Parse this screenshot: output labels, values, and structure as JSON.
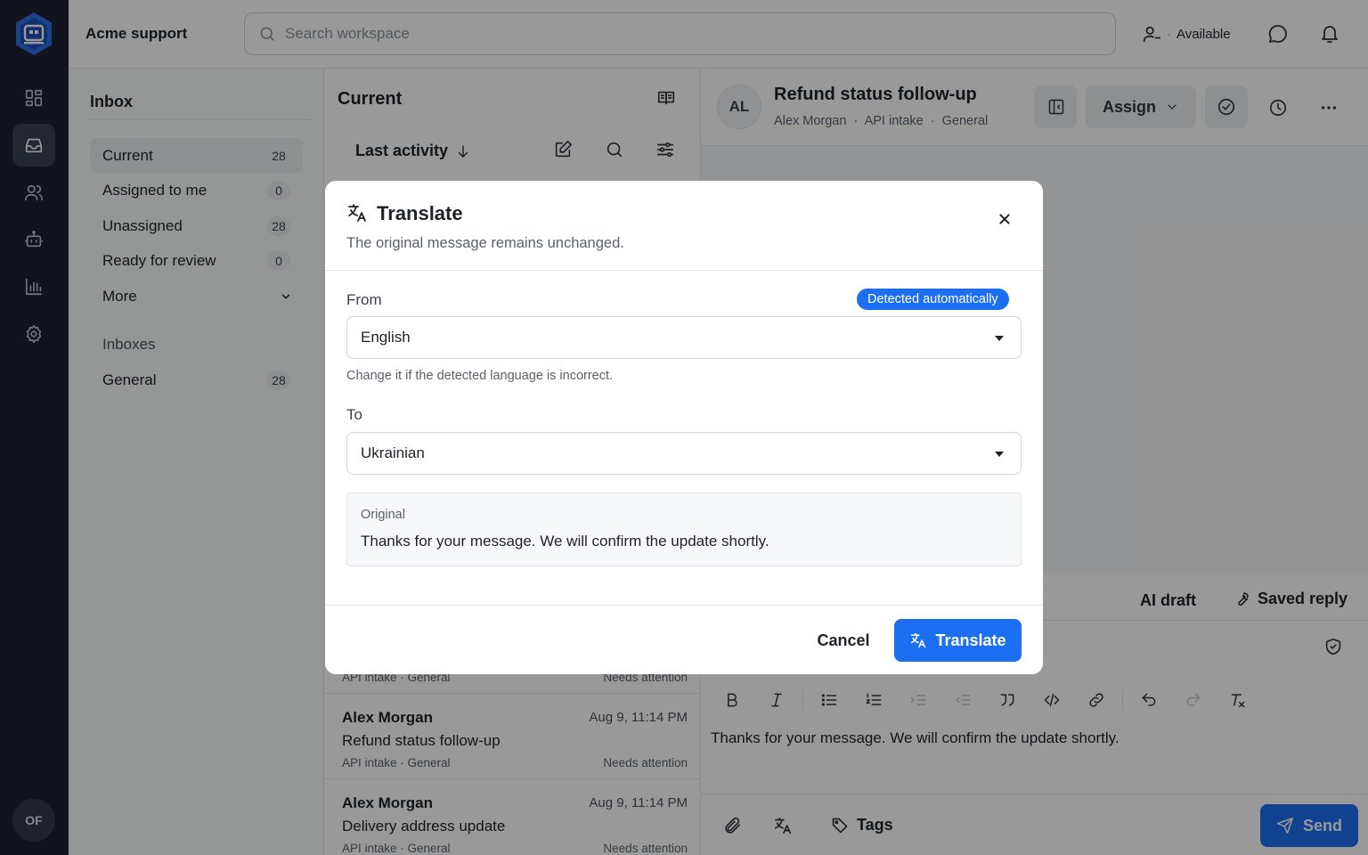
{
  "app": {
    "workspace_name": "Acme support",
    "user_initials": "OF",
    "status": "Available"
  },
  "search": {
    "placeholder": "Search workspace"
  },
  "rail": {
    "items": [
      "dashboard-icon",
      "inbox-icon",
      "contacts-icon",
      "bot-icon",
      "reports-icon",
      "settings-icon"
    ],
    "active": "inbox-icon"
  },
  "inbox_panel": {
    "title": "Inbox",
    "items": [
      {
        "label": "Current",
        "count": "28"
      },
      {
        "label": "Assigned to me",
        "count": "0"
      },
      {
        "label": "Unassigned",
        "count": "28"
      },
      {
        "label": "Ready for review",
        "count": "0"
      },
      {
        "label": "More"
      }
    ],
    "inboxes_title": "Inboxes",
    "inboxes": [
      {
        "label": "General",
        "count": "28"
      }
    ]
  },
  "list": {
    "title": "Current",
    "sort_label": "Last activity",
    "peek": {
      "meta": "API intake · General",
      "status": "Needs attention"
    },
    "conversations": [
      {
        "name": "Alex Morgan",
        "time": "Aug 9, 11:14 PM",
        "subject": "Refund status follow-up",
        "meta": "API intake · General",
        "status": "Needs attention"
      },
      {
        "name": "Alex Morgan",
        "time": "Aug 9, 11:14 PM",
        "subject": "Delivery address update",
        "meta": "API intake · General",
        "status": "Needs attention"
      }
    ]
  },
  "conversation": {
    "avatar": "AL",
    "title": "Refund status follow-up",
    "contact": "Alex Morgan",
    "source": "API intake",
    "inbox": "General",
    "sep": "·",
    "assign_label": "Assign"
  },
  "composer": {
    "ai_draft": "AI draft",
    "saved_reply": "Saved reply",
    "text": "Thanks for your message. We will confirm the update shortly.",
    "tags_label": "Tags",
    "send_label": "Send"
  },
  "modal": {
    "title": "Translate",
    "description": "The original message remains unchanged.",
    "from_label": "From",
    "detected_badge": "Detected automatically",
    "from_value": "English",
    "hint": "Change it if the detected language is incorrect.",
    "to_label": "To",
    "to_value": "Ukrainian",
    "original_label": "Original",
    "original_text": "Thanks for your message. We will confirm the update shortly.",
    "cancel_label": "Cancel",
    "translate_label": "Translate"
  },
  "colors": {
    "primary": "#1c6ef2",
    "rail": "#1d2233",
    "overlay": "rgba(0,0,0,0.4)"
  }
}
